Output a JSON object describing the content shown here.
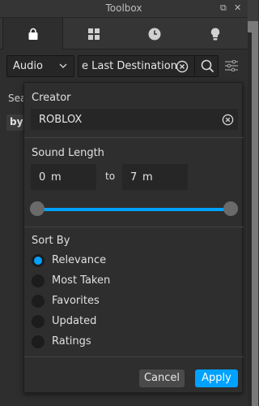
{
  "window": {
    "title": "Toolbox",
    "buttons": {
      "restore": "⧉",
      "close": "✕"
    }
  },
  "tabs": [
    {
      "name": "marketplace",
      "icon": "shopping-bag-icon",
      "active": true
    },
    {
      "name": "inventory",
      "icon": "grid-icon",
      "active": false
    },
    {
      "name": "recent",
      "icon": "clock-icon",
      "active": false
    },
    {
      "name": "creations",
      "icon": "lightbulb-icon",
      "active": false
    }
  ],
  "search": {
    "category": "Audio",
    "query": "e Last Destination"
  },
  "background": {
    "search_label_partial": "Sea",
    "by_label_partial": "by"
  },
  "filter_panel": {
    "creator_label": "Creator",
    "creator_value": "ROBLOX",
    "length_label": "Sound Length",
    "min_length": "0",
    "max_length": "7",
    "unit": "m",
    "to_label": "to",
    "sort_label": "Sort By",
    "sort_options": [
      "Relevance",
      "Most Taken",
      "Favorites",
      "Updated",
      "Ratings"
    ],
    "selected_sort": "Relevance",
    "cancel_label": "Cancel",
    "apply_label": "Apply"
  },
  "colors": {
    "accent": "#00a2ff",
    "panel_bg": "#2e2e2e",
    "field_bg": "#262626",
    "titlebar_bg": "#353535"
  }
}
